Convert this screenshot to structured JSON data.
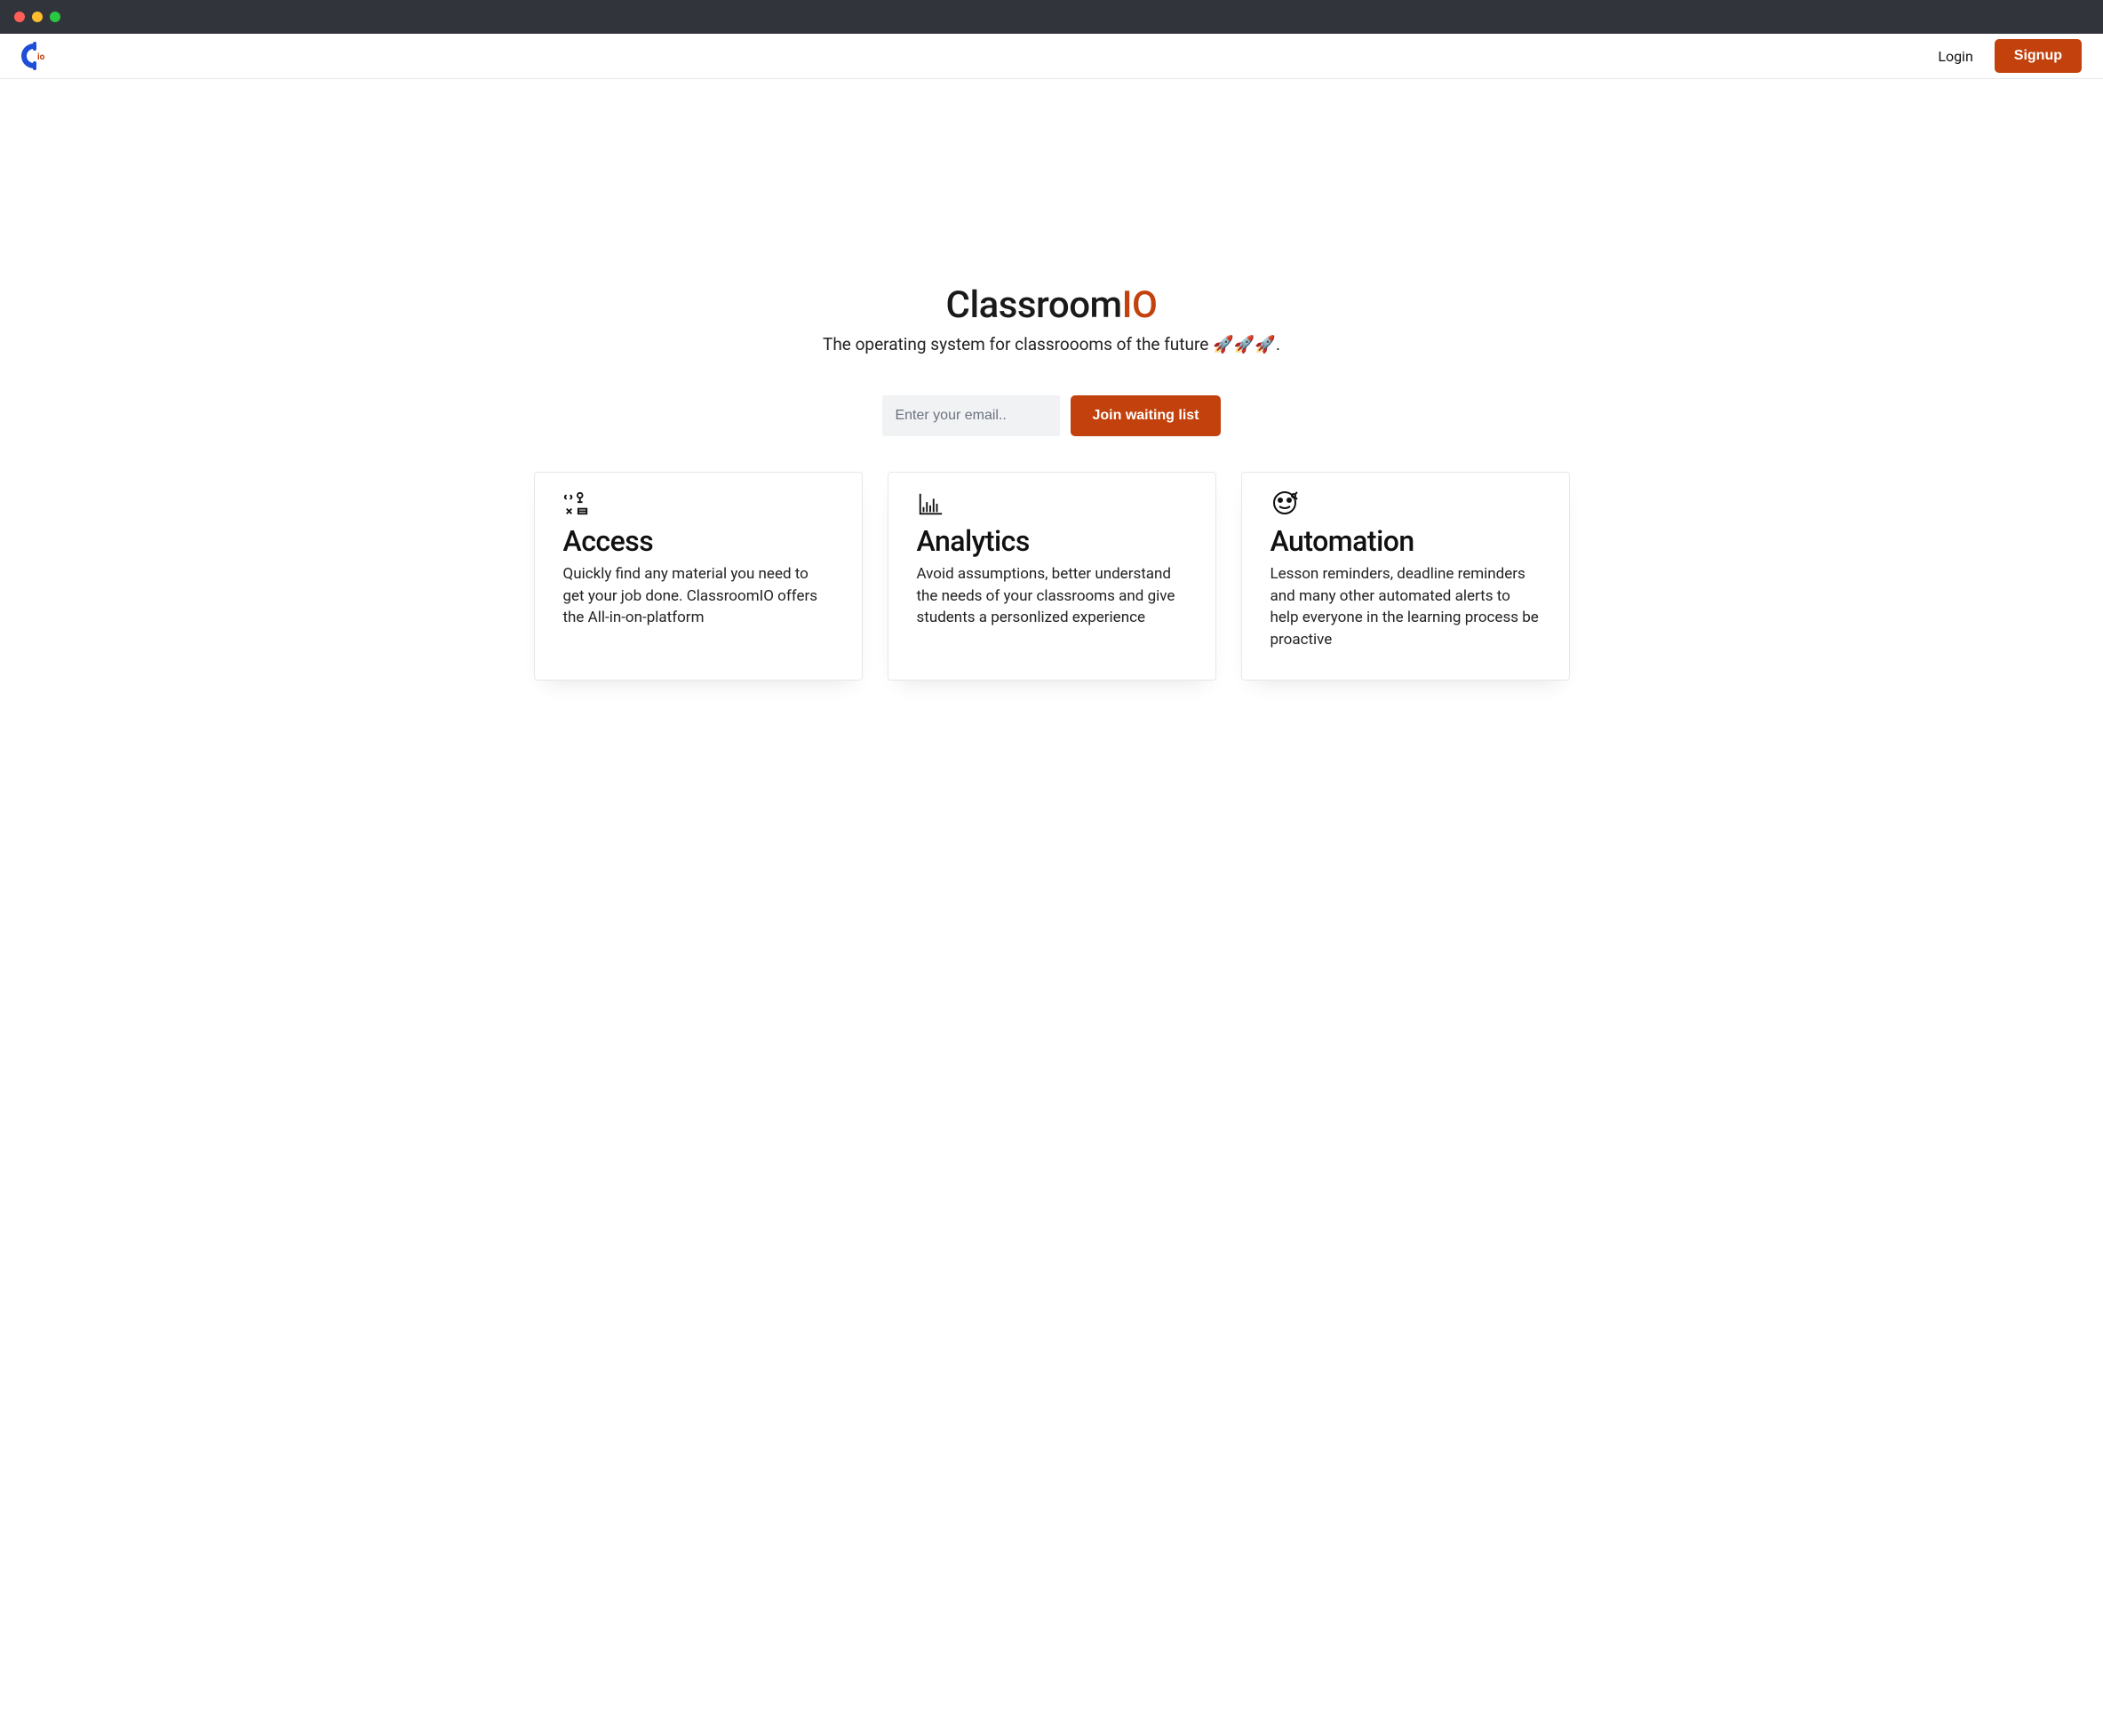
{
  "header": {
    "login_label": "Login",
    "signup_label": "Signup"
  },
  "hero": {
    "title_prefix": "Classroom",
    "title_accent": "IO",
    "subtitle": "The operating system for classroooms of the future 🚀🚀🚀."
  },
  "waitlist": {
    "email_placeholder": "Enter your email..",
    "join_label": "Join waiting list"
  },
  "features": [
    {
      "title": "Access",
      "desc": "Quickly find any material you need to get your job done. ClassroomIO offers the All-in-on-platform"
    },
    {
      "title": "Analytics",
      "desc": "Avoid assumptions, better understand the needs of your classrooms and give students a personlized experience"
    },
    {
      "title": "Automation",
      "desc": "Lesson reminders, deadline reminders and many other automated alerts to help everyone in the learning process be proactive"
    }
  ],
  "colors": {
    "accent": "#c2410c"
  }
}
